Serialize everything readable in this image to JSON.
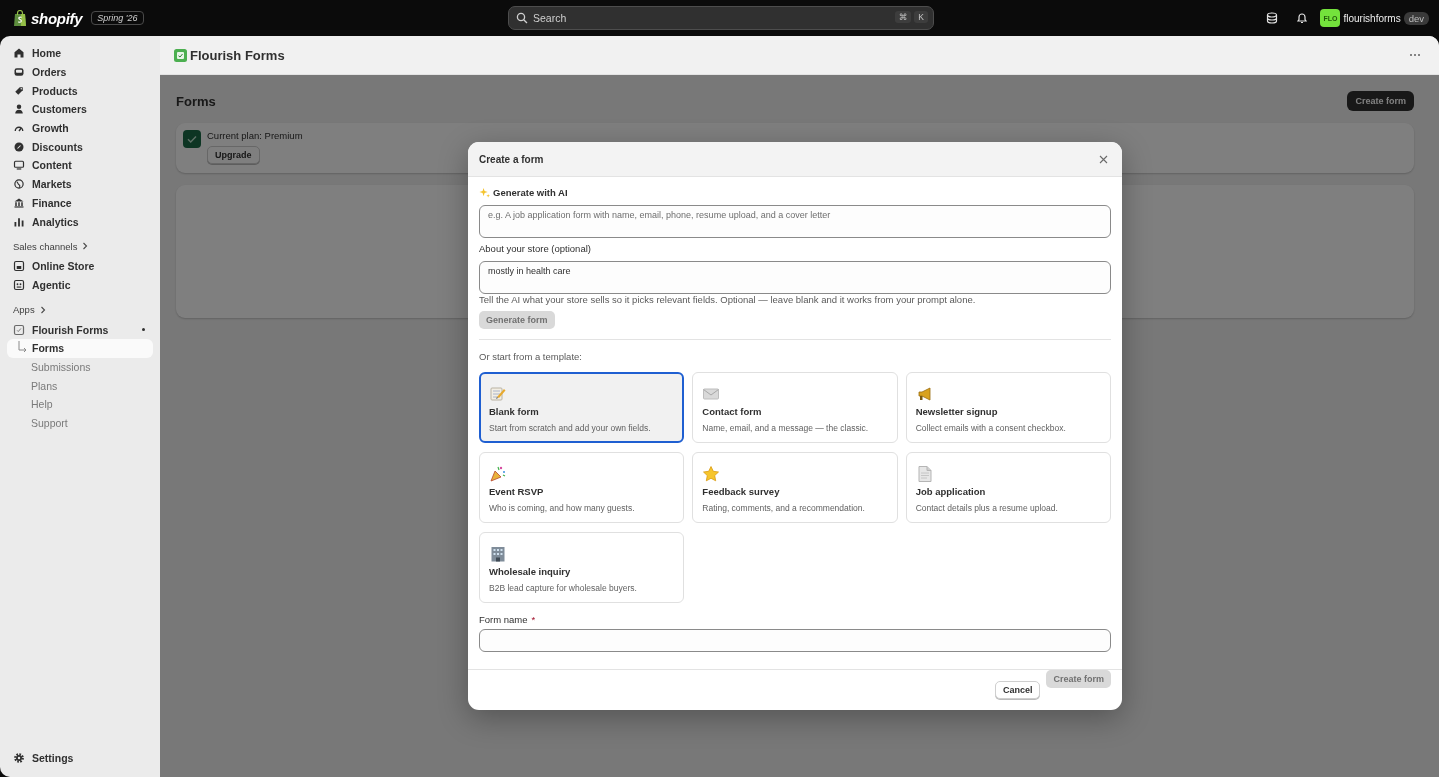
{
  "topbar": {
    "brand": "shopify",
    "edition": "Spring '26",
    "search_placeholder": "Search",
    "shortcut_keys": [
      "⌘",
      "K"
    ],
    "store": {
      "avatar": "FLO",
      "name": "flourishforms",
      "badge": "dev"
    }
  },
  "sidebar": {
    "items": [
      {
        "label": "Home",
        "kind": "home",
        "selected": false
      },
      {
        "label": "Orders",
        "kind": "orders",
        "selected": false
      },
      {
        "label": "Products",
        "kind": "tag",
        "selected": false
      },
      {
        "label": "Customers",
        "kind": "person",
        "selected": false
      },
      {
        "label": "Growth",
        "kind": "gauge",
        "selected": false
      },
      {
        "label": "Discounts",
        "kind": "discount",
        "selected": false
      },
      {
        "label": "Content",
        "kind": "monitor",
        "selected": false
      },
      {
        "label": "Markets",
        "kind": "globe",
        "selected": false
      },
      {
        "label": "Finance",
        "kind": "bank",
        "selected": false
      },
      {
        "label": "Analytics",
        "kind": "bars",
        "selected": false
      }
    ],
    "sales_channels": {
      "heading": "Sales channels",
      "items": [
        {
          "label": "Online Store",
          "kind": "store",
          "selected": false
        },
        {
          "label": "Agentic",
          "kind": "agent",
          "selected": false
        }
      ]
    },
    "apps": {
      "heading": "Apps",
      "items": [
        {
          "label": "Flourish Forms",
          "kind": "app",
          "selected": false,
          "children": [
            {
              "label": "Forms",
              "selected": true
            },
            {
              "label": "Submissions",
              "selected": false
            },
            {
              "label": "Plans",
              "selected": false
            },
            {
              "label": "Help",
              "selected": false
            },
            {
              "label": "Support",
              "selected": false
            }
          ]
        }
      ]
    },
    "settings": {
      "label": "Settings",
      "kind": "gear",
      "selected": false
    }
  },
  "app_header": {
    "title": "Flourish Forms"
  },
  "page": {
    "title": "Forms",
    "primary_action": "Create form",
    "plan_card": {
      "text": "Current plan: Premium",
      "button": "Upgrade"
    }
  },
  "modal": {
    "title": "Create a form",
    "ai_heading": "Generate with AI",
    "prompt": {
      "placeholder": "e.g. A job application form with name, email, phone, resume upload, and a cover letter"
    },
    "store_field": {
      "label": "About your store (optional)",
      "value": "mostly in health care",
      "help": "Tell the AI what your store sells so it picks relevant fields. Optional — leave blank and it works from your prompt alone."
    },
    "generate_button": {
      "label": "Generate form",
      "disabled": true
    },
    "templates_heading": "Or start from a template:",
    "templates": [
      {
        "kind": "memo",
        "title": "Blank form",
        "description": "Start from scratch and add your own fields.",
        "selected": true
      },
      {
        "kind": "envelope",
        "title": "Contact form",
        "description": "Name, email, and a message — the classic.",
        "selected": false
      },
      {
        "kind": "megaphone",
        "title": "Newsletter signup",
        "description": "Collect emails with a consent checkbox.",
        "selected": false
      },
      {
        "kind": "party",
        "title": "Event RSVP",
        "description": "Who is coming, and how many guests.",
        "selected": false
      },
      {
        "kind": "star",
        "title": "Feedback survey",
        "description": "Rating, comments, and a recommendation.",
        "selected": false
      },
      {
        "kind": "document",
        "title": "Job application",
        "description": "Contact details plus a resume upload.",
        "selected": false
      },
      {
        "kind": "building",
        "title": "Wholesale inquiry",
        "description": "B2B lead capture for wholesale buyers.",
        "selected": false
      }
    ],
    "name_field": {
      "label": "Form name",
      "required": true,
      "required_mark": "*"
    },
    "cancel_button": {
      "label": "Cancel"
    },
    "create_button": {
      "label": "Create form",
      "disabled": true
    }
  }
}
